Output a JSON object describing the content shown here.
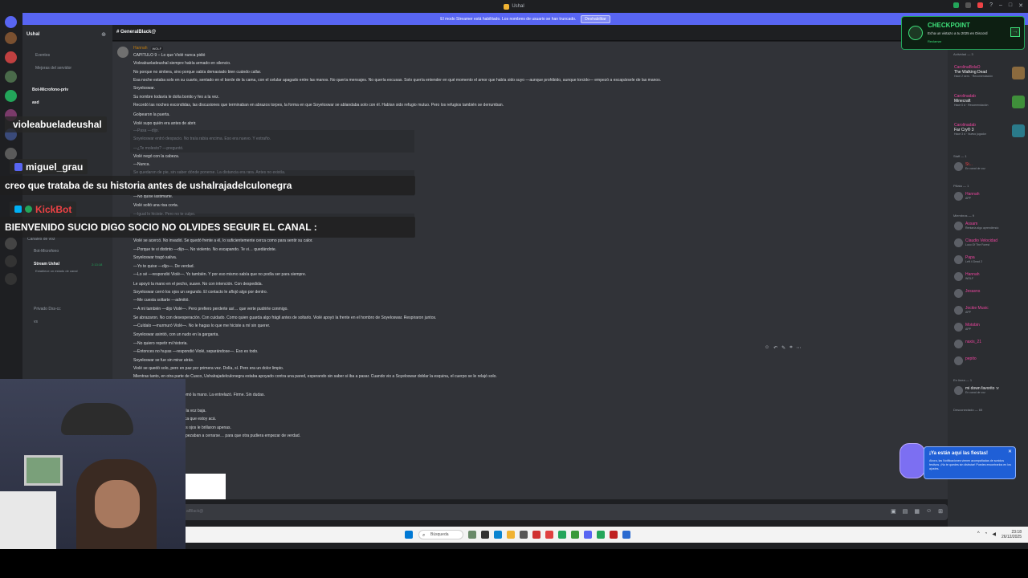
{
  "window": {
    "title": "Ushal"
  },
  "banner": {
    "text": "El modo Streamer está habilitado. Los nombres de usuario se han truncado.",
    "button": "Deshabilitar"
  },
  "checkpoint": {
    "title": "CHECKPOINT",
    "subtitle": "Echa un vistazo a tu 2025 en Discord",
    "link": "Reclamar"
  },
  "sidebar": {
    "server_name": "Ushal",
    "items": [
      {
        "label": "Eventos"
      },
      {
        "label": "Mejoras del servidor"
      },
      {
        "label": "Bot-Microfono-priv"
      },
      {
        "label": "asd"
      },
      {
        "label": "Canales de voz"
      },
      {
        "label": "Bot-Microfono"
      },
      {
        "label": "Stream Ushal",
        "sub": "Establece un estado de canal",
        "time": "2:13:18"
      },
      {
        "label": "Privado Dss-cc"
      },
      {
        "label": "vs"
      }
    ]
  },
  "channel": {
    "name": "GeneralBlack@"
  },
  "message": {
    "author": "Hannah",
    "tag": "WOLF",
    "lines": [
      "CAPITULO 9 – Lo que Violé nunca pidió",
      "Violeabueladeushal siempre había armado en silencio.",
      "No porque no sintiera, sino porque sabía demasiado bien cuándo callar.",
      "Esa noche estaba solo en su cuarto, sentado en el borde de la cama, con el celular apagado entre las manos. No quería mensajes. No quería excusas. Solo quería entender en qué momento el amor que había sido suyo —aunque prohibido, aunque torcido— empezó a escapársele de las manos.",
      "Soyeloswar.",
      "Su nombre todavía le dolía bonito y feo a la vez.",
      "Recordó las noches escondidas, las discusiones que terminaban en abrazos torpes, la forma en que Soyeloswar se ablandaba solo con él. Habían sido refugio mutuo. Pero los refugios también se derrumban.",
      "Golpearon la puerta.",
      "Violé supo quién era antes de abrir.",
      "—Pasa —dijo.",
      "Soyeloswar entró despacio. No traía rabia encima. Eso era nuevo. Y extraño.",
      "—¿Te molesto? —preguntó.",
      "Violé negó con la cabeza.",
      "—Nunca.",
      "Se quedaron de pie, sin saber dónde ponerse. La distancia era rara. Antes no existía.",
      "Soyeloswar bajó la mirada.",
      "—No quise lastimarte.",
      "Violé soltó una risa corta.",
      "—Igual lo hiciste. Pero no te culpo.",
      "—¿Por qué no?",
      "Violé se acercó. No invadió. Se quedó frente a él, lo suficientemente cerca como para sentir su calor.",
      "—Porque te vi distinto —dijo—. No violento. No escapando. Te vi… quedándote.",
      "Soyeloswar tragó saliva.",
      "—Yo te quise —dijo—. De verdad.",
      "—Lo sé —respondió Violé—. Yo también. Y por eso mismo sabía que no podía ser para siempre.",
      "Le apoyó la mano en el pecho, suave. No con intención. Con despedida.",
      "Soyeloswar cerró los ojos un segundo. El contacto le aflojó algo por dentro.",
      "—Me cuesta soltarte —admitió.",
      "—A mí también —dijo Violé—. Pero prefiero perderte así… que verte pudrirte conmigo.",
      "Se abrazaron. No con desesperación. Con cuidado. Como quien guarda algo frágil antes de soltarlo. Violé apoyó la frente en el hombro de Soyeloswar. Respiraron juntos.",
      "—Cuídalo —murmuró Violé—. No le hagas lo que me hiciste a mí sin querer.",
      "Soyeloswar asintió, con un nudo en la garganta.",
      "—No quiero repetir mi historia.",
      "—Entonces no huyas —respondió Violé, separándose—. Eso es todo.",
      "Soyeloswar se fue sin mirar atrás.",
      "Violé se quedó solo, pero en paz por primera vez. Dolía, sí. Pero era un dolor limpio.",
      "Mientras tanto, en otra parte de Cusco, Ushalrajadelculonegra estaba apoyado contra una pared, esperando sin saber si iba a pasar. Cuando vio a Soyeloswar doblar la esquina, el cuerpo se le relajó solo.",
      "—dijo.",
      "hablar. Le tomó la mano. La entrelazó. Firme. Sin dudas.",
      "ido.",
      "egantó. con la voz baja.",
      "ar—. Significa que estoy acá.",
      "io sonrió. Los ojos le brillaron apenas.",
      "historias empezaban a cerrarse… para que otra pudiera empezar de verdad."
    ]
  },
  "composer": {
    "placeholder": "alBlack@"
  },
  "overlay": {
    "user1": "violeabueladeushal",
    "user2": "miguel_grau",
    "msg1": "creo que trataba de su historia antes de ushalrajadelculonegra",
    "user3": "KickBot",
    "msg2": "BIENVENIDO SUCIO DIGO SOCIO NO OLVIDES SEGUIR EL CANAL :"
  },
  "members": {
    "activity_head": "Actividad — 3",
    "activities": [
      {
        "name": "CarolinaBolaO",
        "game": "The Walking Dead",
        "sub": "Hace 2 sem. · Recomendación",
        "color": "#8b6a3e"
      },
      {
        "name": "Carolinadab",
        "game": "Minecraft",
        "sub": "Hace 0 d · Recomendación",
        "color": "#3f8f3a"
      },
      {
        "name": "Carolinadab",
        "game": "Far Cry® 3",
        "sub": "Hace 3 d · Nuevo jugador",
        "color": "#2a7a8a"
      }
    ],
    "groups": [
      {
        "head": "Staff — 1",
        "rows": [
          {
            "name": "St...",
            "sub": "En canal de voz",
            "cls": "red"
          }
        ]
      },
      {
        "head": "Pillata — 1",
        "rows": [
          {
            "name": "Hannah",
            "sub": "APP",
            "cls": "pink"
          }
        ]
      },
      {
        "head": "Miembros — 9",
        "rows": [
          {
            "name": "Assam",
            "sub": "Rentaría algo aprendiendo",
            "cls": "pink"
          },
          {
            "name": "Claudio Velocidad",
            "sub": "Loco Of The Forest",
            "cls": "pink"
          },
          {
            "name": "Papa",
            "sub": "Left 4 Dead 2",
            "cls": "pink"
          },
          {
            "name": "Hannah",
            "sub": "WOLF",
            "cls": "pink"
          },
          {
            "name": "Jesasns",
            "sub": "",
            "cls": "pink"
          },
          {
            "name": "Jockie Music",
            "sub": "APP",
            "cls": "pink"
          },
          {
            "name": "Motobin",
            "sub": "APP",
            "cls": "pink"
          },
          {
            "name": "naxis_21",
            "sub": "",
            "cls": "pink"
          },
          {
            "name": "pepito",
            "sub": "",
            "cls": "pink"
          }
        ]
      },
      {
        "head": "En línea — 1",
        "rows": [
          {
            "name": "mi down favorito :v",
            "sub": "En canal de voz",
            "cls": ""
          }
        ]
      },
      {
        "head": "Desconectado — 65",
        "rows": []
      }
    ]
  },
  "promo": {
    "title": "¡Ya están aquí las fiestas!",
    "body": "Ahora, las Notificaciones vienen acompañadas de sonidos festivos. ¡No te quedes sin disfrutar! Puedes encontrarlos en los ajustes."
  },
  "taskbar": {
    "search": "Búsqueda",
    "time": "23:18",
    "date": "26/12/2025"
  }
}
